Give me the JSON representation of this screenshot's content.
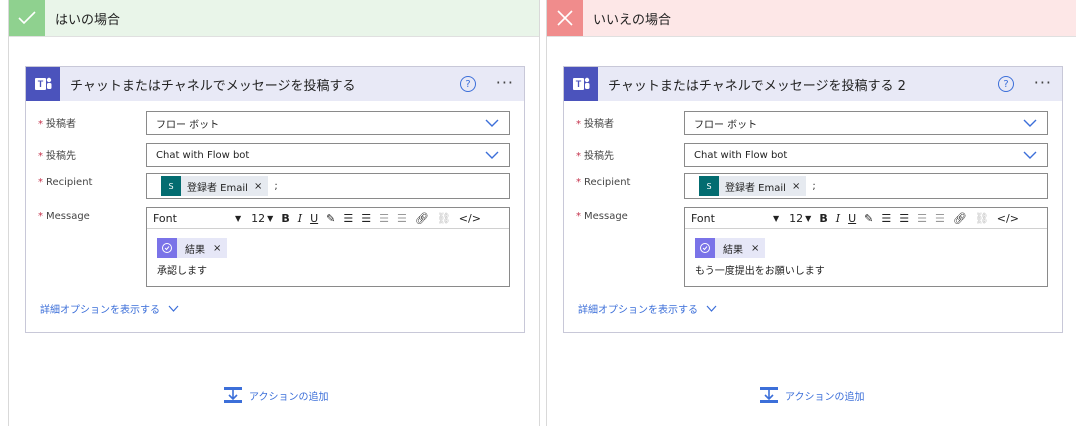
{
  "branches": [
    {
      "title": "はいの場合",
      "status": "yes",
      "card": {
        "title": "チャットまたはチャネルでメッセージを投稿する",
        "help_icon": "?",
        "more_icon": "···",
        "poster_label": "投稿者",
        "poster_value": "フロー ボット",
        "dest_label": "投稿先",
        "dest_value": "Chat with Flow bot",
        "recipient_label": "Recipient",
        "recipient_token": "登録者 Email",
        "recipient_token_close": "×",
        "recipient_sep": ";",
        "message_label": "Message",
        "toolbar_font": "Font",
        "toolbar_size": "12",
        "message_token": "結果",
        "message_token_close": "×",
        "message_text": "承認します",
        "advanced_link": "詳細オプションを表示する"
      },
      "add_action": "アクションの追加"
    },
    {
      "title": "いいえの場合",
      "status": "no",
      "card": {
        "title": "チャットまたはチャネルでメッセージを投稿する 2",
        "help_icon": "?",
        "more_icon": "···",
        "poster_label": "投稿者",
        "poster_value": "フロー ボット",
        "dest_label": "投稿先",
        "dest_value": "Chat with Flow bot",
        "recipient_label": "Recipient",
        "recipient_token": "登録者 Email",
        "recipient_token_close": "×",
        "recipient_sep": ";",
        "message_label": "Message",
        "toolbar_font": "Font",
        "toolbar_size": "12",
        "message_token": "結果",
        "message_token_close": "×",
        "message_text": "もう一度提出をお願いします",
        "advanced_link": "詳細オプションを表示する"
      },
      "add_action": "アクションの追加"
    }
  ],
  "icons": {
    "yes_icon": "check-icon",
    "no_icon": "close-icon",
    "card_icon": "teams-icon",
    "token_icon": "sharepoint-icon",
    "flow_token_icon": "approval-icon"
  },
  "colors": {
    "yes_bg": "#e9f5e9",
    "yes_accent": "#8fd18f",
    "no_bg": "#fde7e7",
    "no_accent": "#f08c8c",
    "teams": "#4b53bc",
    "link": "#3c6fd9",
    "required": "#c4314b"
  }
}
